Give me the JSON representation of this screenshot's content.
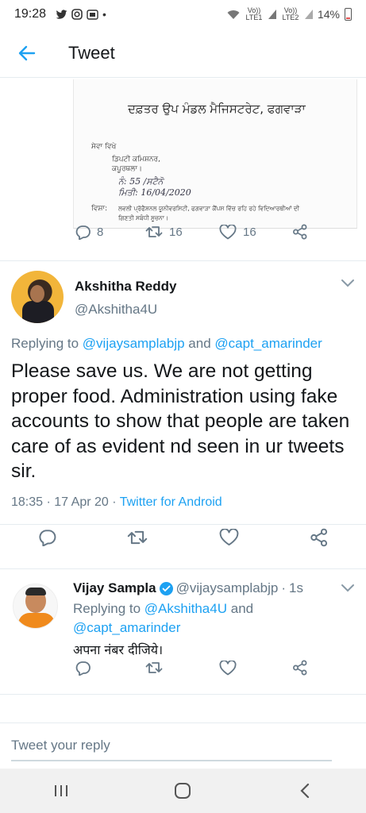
{
  "status_bar": {
    "time": "19:28",
    "left_icons": [
      "twitter-icon",
      "instagram-icon",
      "app-icon",
      "dot-icon"
    ],
    "network_1": "Vo)) LTE1",
    "network_2": "Vo)) LTE2",
    "battery": "14%"
  },
  "header": {
    "title": "Tweet"
  },
  "letter_image": {
    "heading": "ਦਫ਼ਤਰ ਉਪ ਮੰਡਲ ਮੈਜਿਸਟਰੇਟ, ਫਗਵਾੜਾ",
    "line_seva": "ਸੇਵਾ ਵਿਖੇ",
    "line_deputy": "ਡਿਪਟੀ ਕਮਿਸ਼ਨਰ,",
    "line_city": "ਕਪੂਰਥਲਾ।",
    "line_number": "ਨੰ: 55 /ਸਟੈਨੋ",
    "line_date": "ਮਿਤੀ: 16/04/2020",
    "line_subject_label": "ਵਿਸ਼ਾ:",
    "line_subject_1": "ਲਵਲੀ ਪ੍ਰੋਫੈਸ਼ਨਲ ਯੂਨੀਵਰਸਿਟੀ, ਫਗਵਾੜਾ ਕੈਂਪਸ ਵਿੱਚ ਰਹਿ ਰਹੇ ਵਿਦਿਆਰਥੀਆਂ ਦੀ",
    "line_subject_2": "ਗਿਣਤੀ ਸਬੰਧੀ ਸੂਚਨਾ।"
  },
  "prev_actions": {
    "replies": "8",
    "retweets": "16",
    "likes": "16"
  },
  "main_tweet": {
    "name": "Akshitha Reddy",
    "handle": "@Akshitha4U",
    "replying_prefix": "Replying to",
    "replying_user1": "@vijaysamplabjp",
    "replying_and": "and",
    "replying_user2": "@capt_amarinder",
    "text": "Please save us. We are not getting proper food. Administration using fake accounts to show that people are taken care of as evident nd seen in ur tweets sir.",
    "time": "18:35",
    "date": "17 Apr 20",
    "source": "Twitter for Android"
  },
  "reply_tweet": {
    "name": "Vijay Sampla",
    "handle": "@vijaysamplabjp",
    "age": "1s",
    "replying_prefix": "Replying to",
    "replying_user1": "@Akshitha4U",
    "replying_and": "and",
    "replying_user2": "@capt_amarinder",
    "text": "अपना नंबर दीजिये।"
  },
  "composer": {
    "placeholder": "Tweet your reply"
  },
  "colors": {
    "accent": "#1da1f2",
    "muted": "#657786",
    "text": "#14171a",
    "divider": "#e6ecf0"
  }
}
